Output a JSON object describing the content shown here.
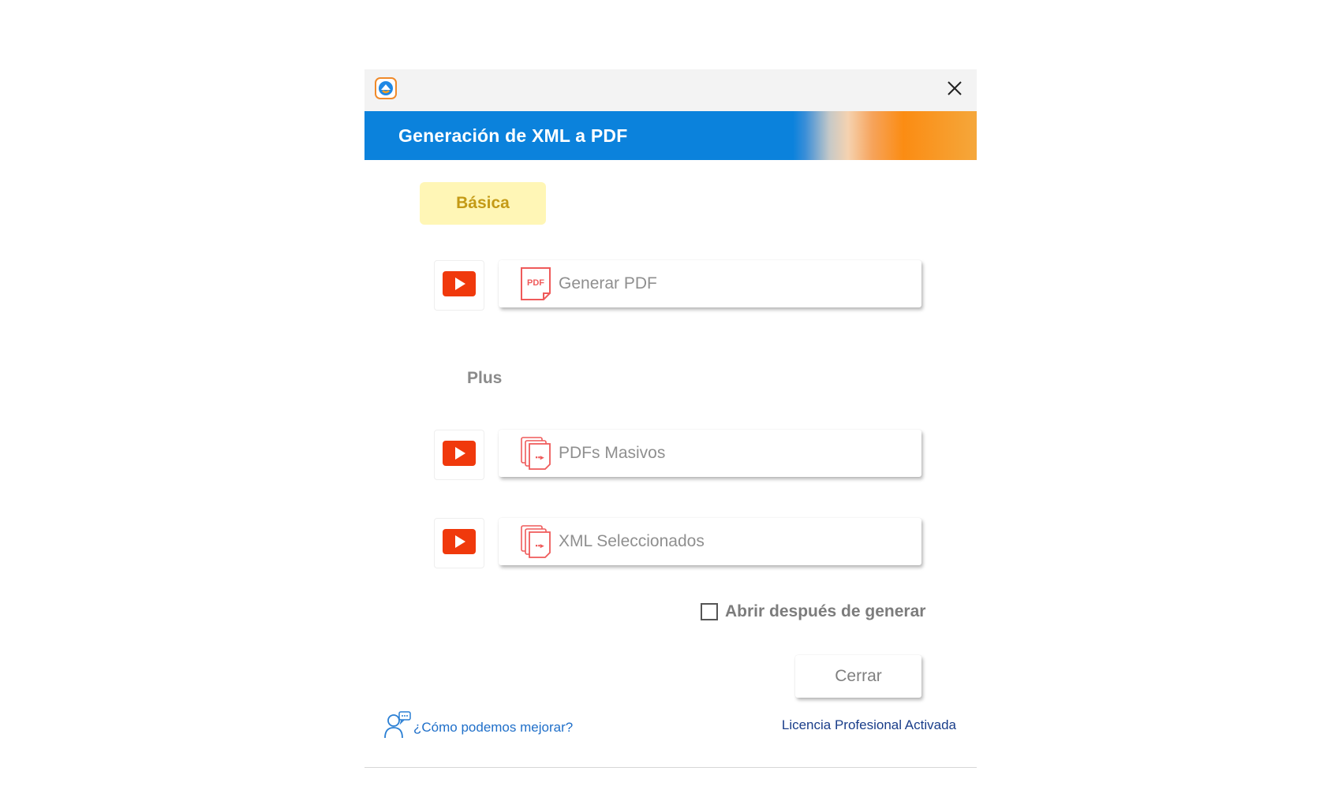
{
  "window": {
    "close_icon": "close-icon",
    "app_icon": "app-logo-icon"
  },
  "header": {
    "title": "Generación de XML a PDF"
  },
  "tabs": {
    "basica": "Básica"
  },
  "sections": {
    "plus": "Plus"
  },
  "actions": [
    {
      "label": "Generar PDF",
      "icon": "pdf-file-icon",
      "video_icon": "video-play-icon"
    },
    {
      "label": "PDFs Masivos",
      "icon": "multiple-files-icon",
      "video_icon": "video-play-icon"
    },
    {
      "label": "XML Seleccionados",
      "icon": "multiple-files-icon",
      "video_icon": "video-play-icon"
    }
  ],
  "options": {
    "open_after_label": "Abrir después de generar",
    "open_after_checked": false
  },
  "footer": {
    "close_button": "Cerrar",
    "feedback_link": "¿Cómo podemos mejorar?",
    "license_text": "Licencia Profesional Activada"
  },
  "colors": {
    "header_blue": "#0b82dc",
    "header_orange": "#fb8c13",
    "tab_bg": "#fff6b6",
    "tab_text": "#c49a16",
    "video_red": "#f0390c",
    "link_blue": "#1f6fc9"
  }
}
